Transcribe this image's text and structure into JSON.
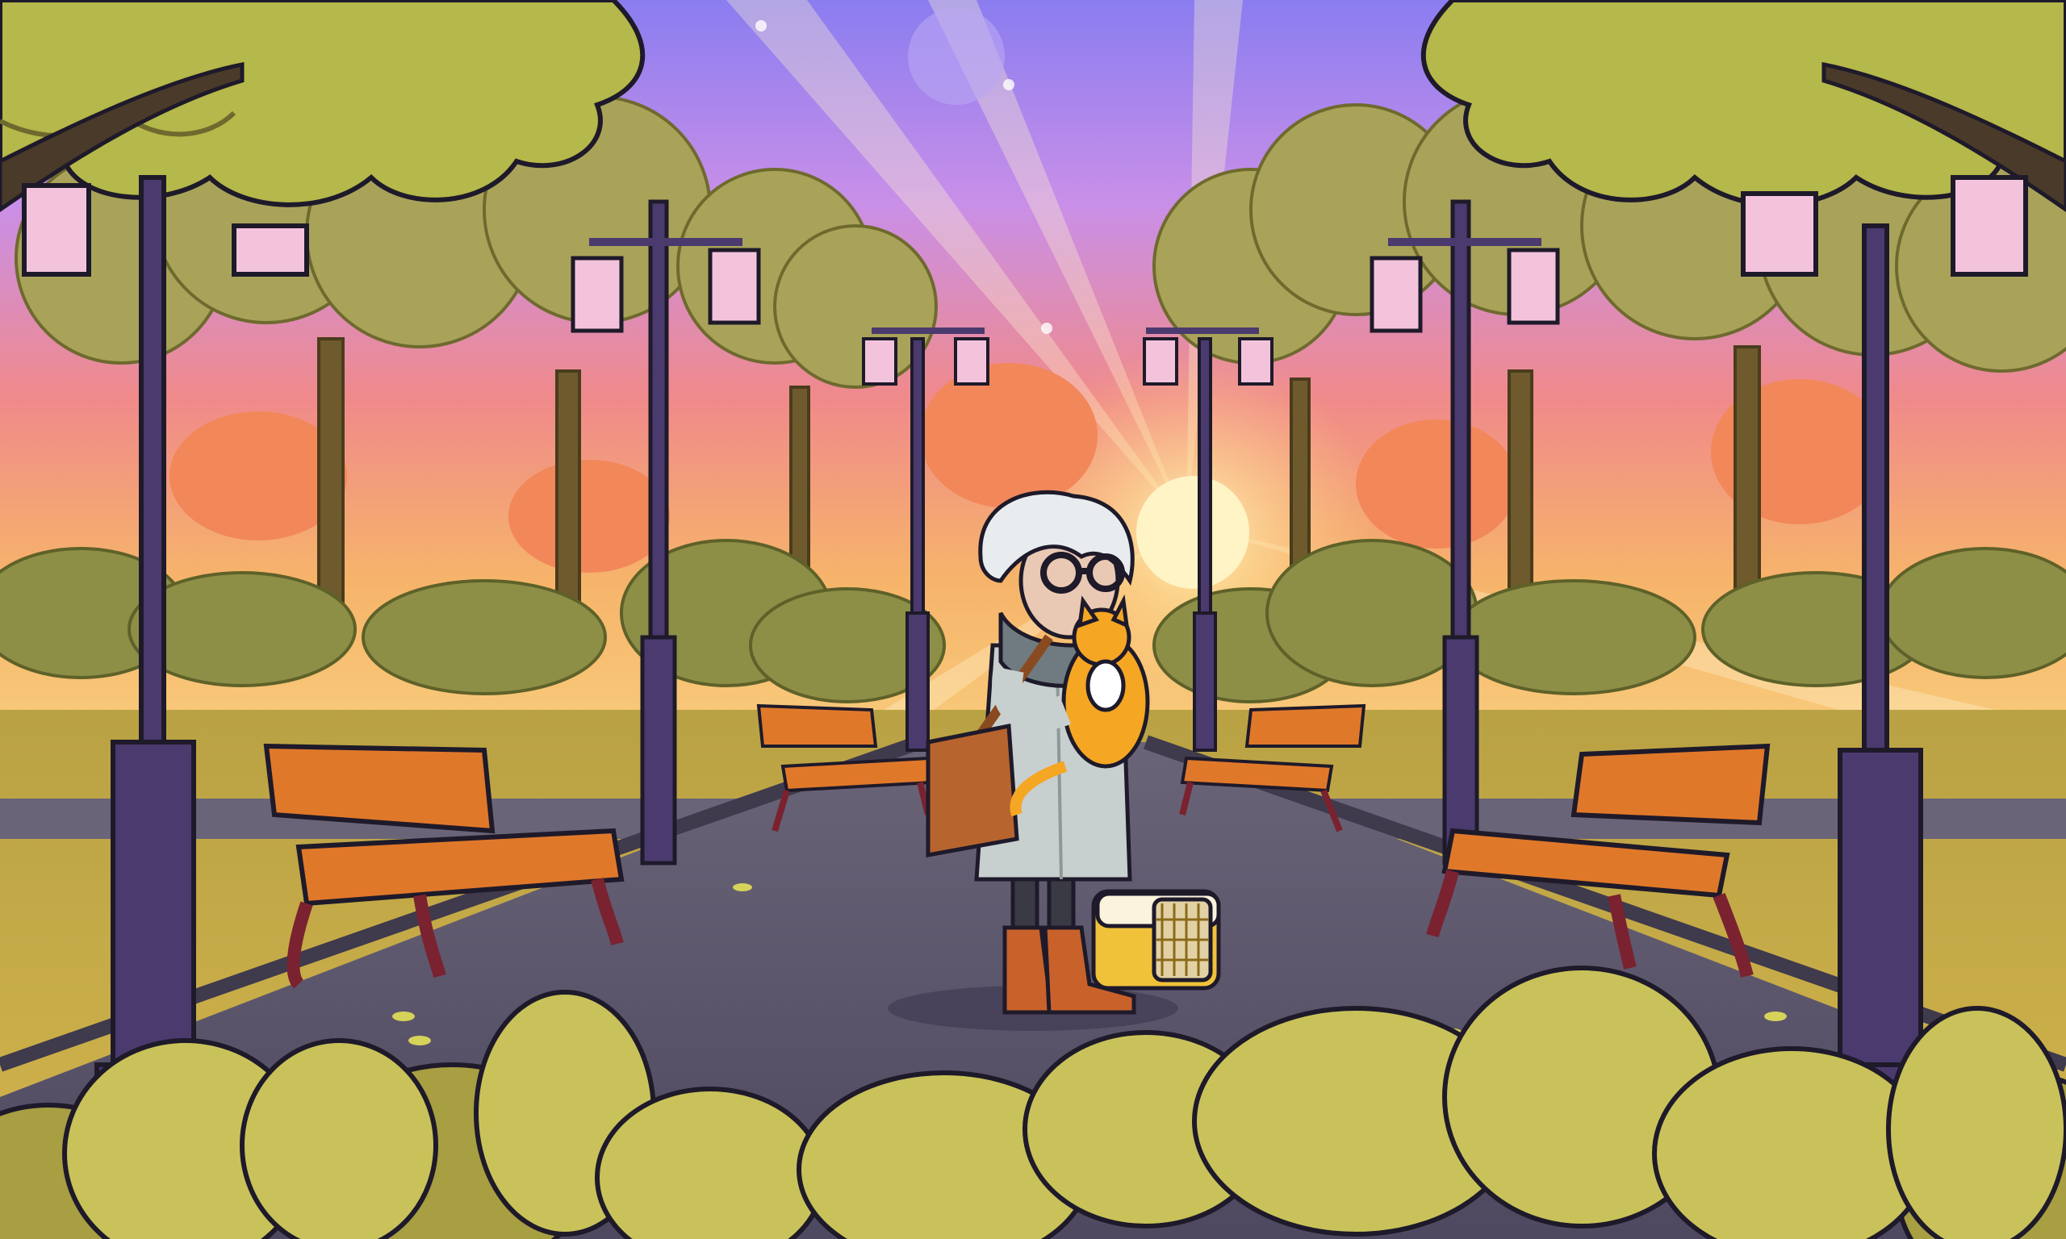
{
  "scene": {
    "description_text": "",
    "palette": {
      "sky_top": "#8a7df0",
      "sky_mid": "#c98fe8",
      "sky_low": "#f08a8a",
      "sky_horizon": "#f6b46a",
      "sun": "#fff4c6",
      "path": "#5a5468",
      "path_edge": "#3f3a4c",
      "grass": "#c9a94a",
      "tree_foliage": "#b5b84a",
      "tree_foliage_dark": "#8f9a3c",
      "distant_foliage": "#9e9a55",
      "trunk": "#6e5a2c",
      "lamp_post": "#4a3a6e",
      "lamp_glass": "#f3c3dc",
      "bench_wood": "#e0782a",
      "bench_frame": "#7a2230",
      "bush": "#c9c25a",
      "bush_dark": "#a89e42",
      "coat": "#c8cfcf",
      "hair": "#e8ecef",
      "cat": "#f5a623",
      "bag": "#b8642e",
      "boots": "#c8622a",
      "carrier": "#f0c23a",
      "outline": "#1e1a2a"
    },
    "elements": {
      "character": "elderly-woman-holding-cat",
      "pet": "orange-cat",
      "carrier": "pet-carrier",
      "bag": "shoulder-bag",
      "benches": 4,
      "lampposts": 6
    }
  }
}
